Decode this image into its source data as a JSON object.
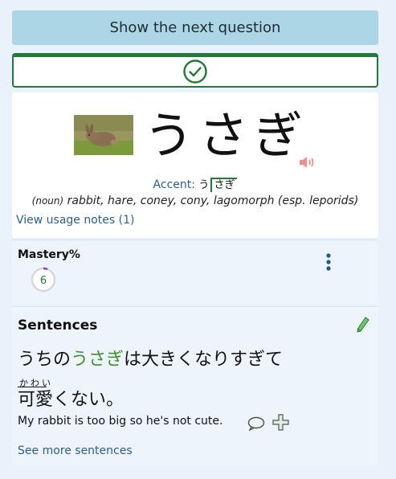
{
  "next_button": {
    "label": "Show the next question"
  },
  "result": {
    "icon": "check-circle-icon",
    "color": "#1f7a35"
  },
  "vocab": {
    "word": "うさぎ",
    "image": "rabbit-photo",
    "accent_label": "Accent:",
    "accent_low": "う",
    "accent_high": "さぎ",
    "pos": "(noun)",
    "definition": "rabbit, hare, coney, cony, lagomorph (esp. leporids)",
    "usage_notes": "View usage notes (1)"
  },
  "mastery": {
    "title": "Mastery%",
    "value": "6",
    "percent": 6
  },
  "sentences": {
    "title": "Sentences",
    "jp_before": "うちの",
    "jp_highlight": "うさぎ",
    "jp_after": "は大きくなりすぎて",
    "jp_line2": "可愛くない。",
    "furigana": "かわい",
    "english": "My rabbit is too big so he's not cute.",
    "see_more": "See more sentences"
  },
  "colors": {
    "accent_green": "#1f7a35",
    "link": "#2d5d8a",
    "button_bg": "#acd6e6",
    "speaker": "#f08f8f"
  }
}
